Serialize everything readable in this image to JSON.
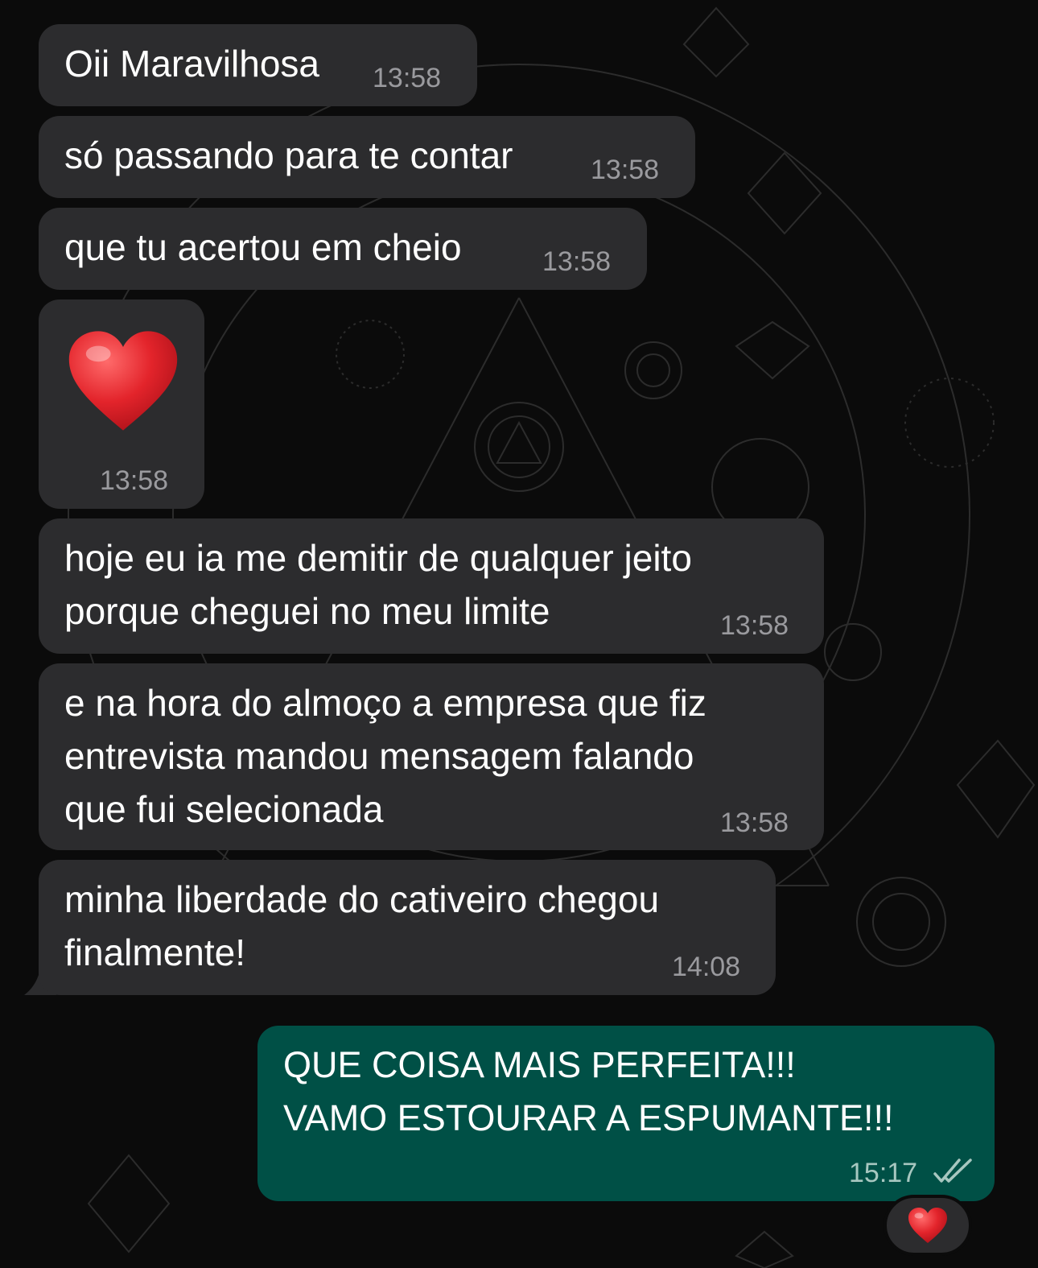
{
  "chat": {
    "messages": [
      {
        "text": "Oii Maravilhosa",
        "time": "13:58"
      },
      {
        "text": "só passando para te contar",
        "time": "13:58"
      },
      {
        "text": "que tu acertou em cheio",
        "time": "13:58"
      },
      {
        "emoji": "heart-emoji",
        "time": "13:58"
      },
      {
        "text": "hoje eu ia me demitir de qualquer jeito\nporque cheguei no meu limite",
        "time": "13:58"
      },
      {
        "text": "e na hora do almoço a empresa que fiz\nentrevista mandou mensagem falando\nque fui selecionada",
        "time": "13:58"
      },
      {
        "text": "minha liberdade do cativeiro chegou\nfinalmente!",
        "time": "14:08"
      }
    ],
    "outgoing": {
      "text": "QUE COISA MAIS PERFEITA!!!\nVAMO ESTOURAR A ESPUMANTE!!!",
      "time": "15:17",
      "status_icon": "double-check-icon",
      "reaction": "heart-emoji"
    }
  },
  "colors": {
    "incoming_bubble": "#2c2c2e",
    "outgoing_bubble": "#005046",
    "background": "#0b0b0b",
    "timestamp": "#9a9a9e",
    "heart": "#e3242b"
  }
}
